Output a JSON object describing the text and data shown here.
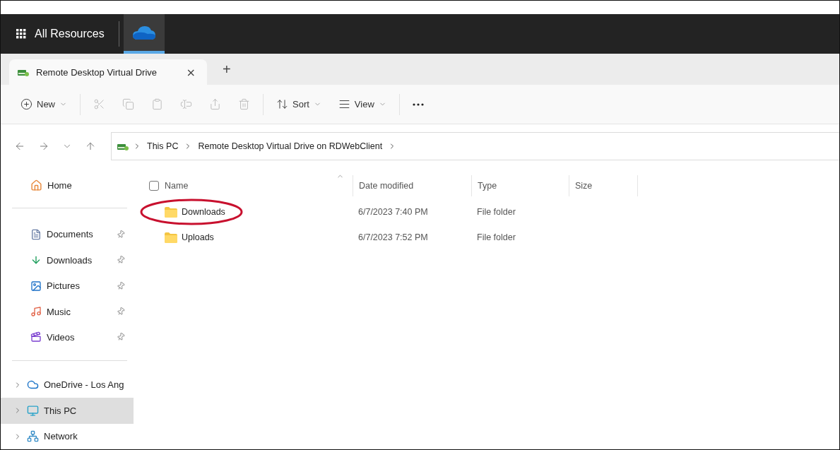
{
  "app_bar": {
    "title": "All Resources",
    "apps": [
      {
        "kind": "cloud",
        "selected": true
      }
    ]
  },
  "tabs": [
    {
      "title": "Remote Desktop Virtual Drive",
      "close": "×",
      "selected": true
    }
  ],
  "new_tab": "+",
  "toolbar": [
    {
      "kind": "new",
      "label": "New",
      "dropdown": true,
      "disabled": false
    },
    {
      "kind": "cut",
      "disabled": true
    },
    {
      "kind": "copy",
      "disabled": true
    },
    {
      "kind": "paste",
      "disabled": true
    },
    {
      "kind": "rename",
      "disabled": true
    },
    {
      "kind": "share",
      "disabled": true
    },
    {
      "kind": "delete",
      "disabled": true
    },
    {
      "kind": "sort",
      "label": "Sort",
      "dropdown": true,
      "disabled": false
    },
    {
      "kind": "view",
      "label": "View",
      "dropdown": true,
      "disabled": false
    },
    {
      "kind": "more",
      "disabled": false
    }
  ],
  "address": {
    "crumbs": [
      "This PC",
      "Remote Desktop Virtual Drive on RDWebClient"
    ]
  },
  "sidebar": {
    "home": {
      "label": "Home",
      "kind": "home",
      "selected": false
    },
    "pinned": [
      {
        "label": "Documents",
        "kind": "documents",
        "pinned": true
      },
      {
        "label": "Downloads",
        "kind": "downloads",
        "pinned": true
      },
      {
        "label": "Pictures",
        "kind": "pictures",
        "pinned": true
      },
      {
        "label": "Music",
        "kind": "music",
        "pinned": true
      },
      {
        "label": "Videos",
        "kind": "videos",
        "pinned": true
      }
    ],
    "locations": [
      {
        "label": "OneDrive - Los Ang",
        "kind": "onedrive",
        "selected": false
      },
      {
        "label": "This PC",
        "kind": "pc",
        "selected": true
      },
      {
        "label": "Network",
        "kind": "network",
        "selected": false
      }
    ]
  },
  "table": {
    "select_all": {
      "checked": false
    },
    "columns": [
      {
        "label": "Name",
        "sorted": true
      },
      {
        "label": "Date modified",
        "sorted": false
      },
      {
        "label": "Type",
        "sorted": false
      },
      {
        "label": "Size",
        "sorted": false
      }
    ],
    "rows": [
      {
        "name": "Downloads",
        "date": "6/7/2023 7:40 PM",
        "type": "File folder",
        "circled": true
      },
      {
        "name": "Uploads",
        "date": "6/7/2023 7:52 PM",
        "type": "File folder",
        "circled": false
      }
    ]
  }
}
